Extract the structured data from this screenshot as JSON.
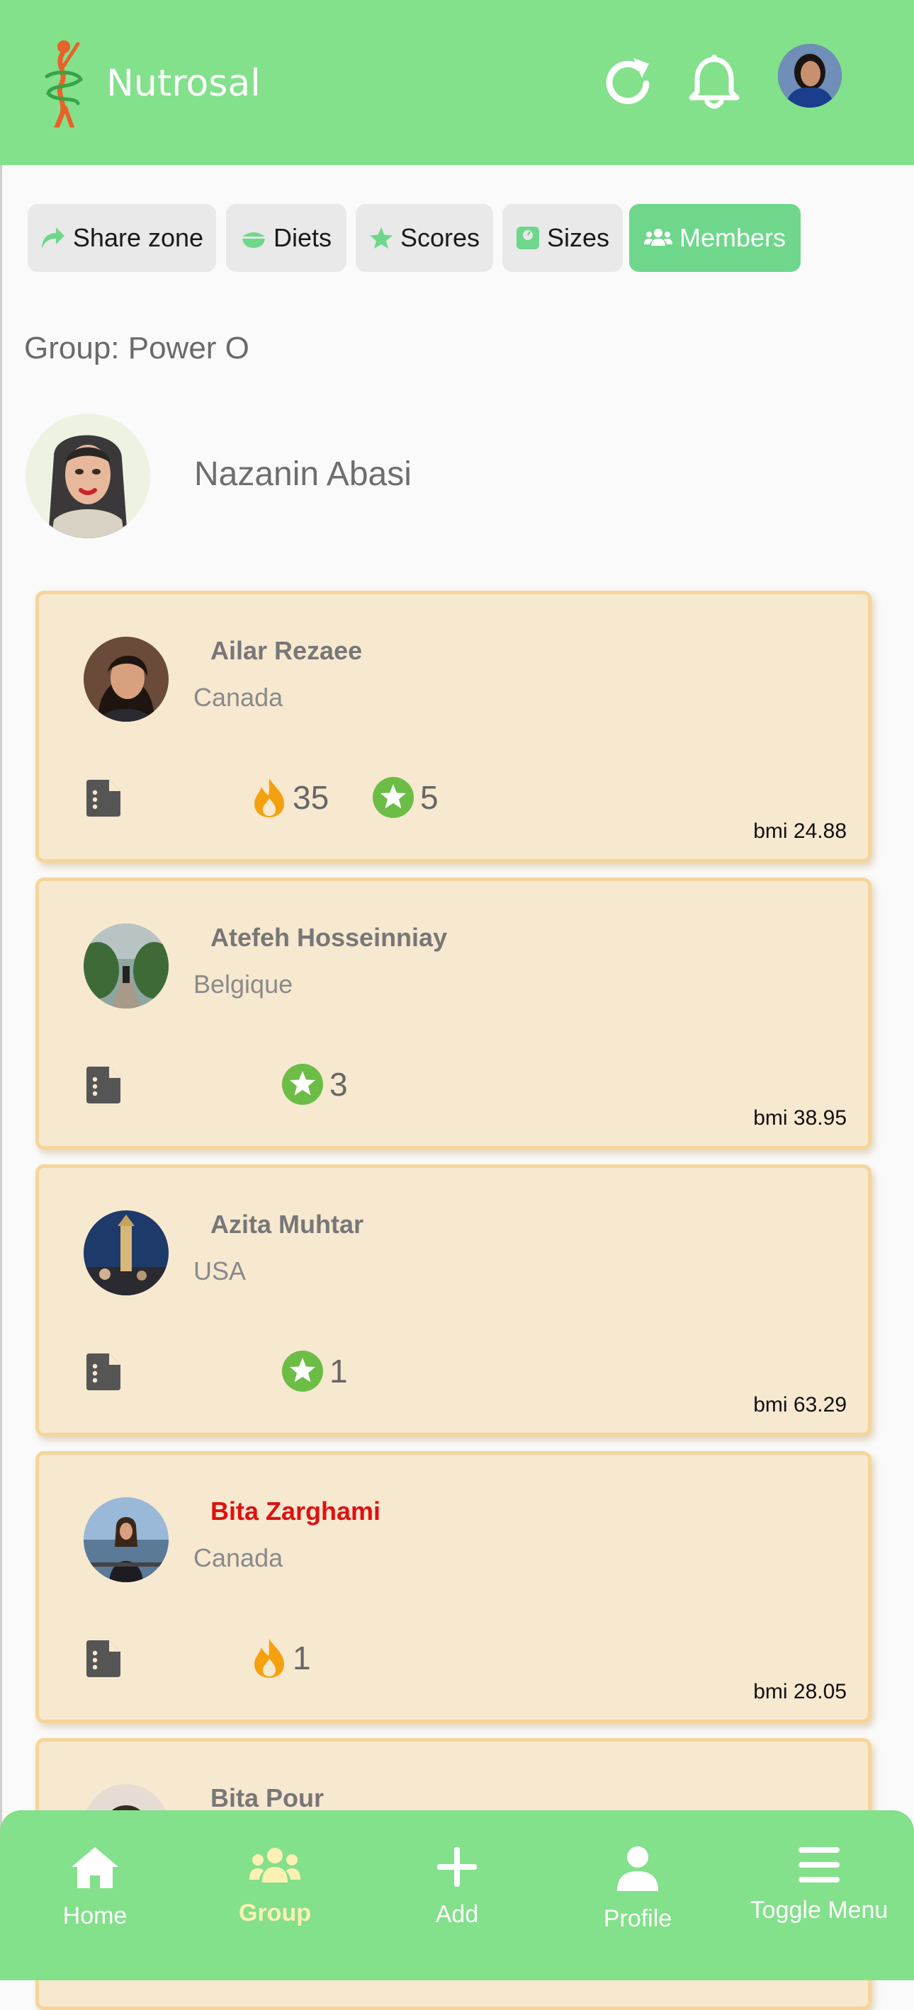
{
  "app": {
    "title": "Nutrosal"
  },
  "tabs": [
    {
      "label": "Share zone",
      "icon": "share-icon"
    },
    {
      "label": "Diets",
      "icon": "bowl-icon"
    },
    {
      "label": "Scores",
      "icon": "star-icon"
    },
    {
      "label": "Sizes",
      "icon": "scale-icon"
    },
    {
      "label": "Members",
      "icon": "users-icon",
      "active": true
    }
  ],
  "group": {
    "title": "Group: Power O",
    "owner_name": "Nazanin Abasi"
  },
  "members": [
    {
      "name": "Ailar Rezaee",
      "country": "Canada",
      "fire": "35",
      "stars": "5",
      "bmi": "bmi 24.88"
    },
    {
      "name": "Atefeh Hosseinniay",
      "country": "Belgique",
      "stars": "3",
      "bmi": "bmi 38.95"
    },
    {
      "name": "Azita Muhtar",
      "country": "USA",
      "stars": "1",
      "bmi": "bmi 63.29"
    },
    {
      "name": "Bita Zarghami",
      "country": "Canada",
      "fire": "1",
      "bmi": "bmi 28.05",
      "name_color": "#e01010"
    },
    {
      "name": "Bita Pour"
    }
  ],
  "nav": [
    {
      "label": "Home",
      "icon": "home-icon"
    },
    {
      "label": "Group",
      "icon": "group-icon",
      "active": true
    },
    {
      "label": "Add",
      "icon": "plus-icon"
    },
    {
      "label": "Profile",
      "icon": "person-icon"
    },
    {
      "label": "Toggle Menu",
      "icon": "menu-icon"
    }
  ],
  "colors": {
    "header_bg": "#83e08b",
    "tab_active": "#6fd78b",
    "card_bg": "#f7e8d0",
    "card_border": "#f6d59a",
    "fire": "#f5a10f",
    "star_circle": "#6cbd45",
    "nav_active": "#fdf0b5"
  }
}
